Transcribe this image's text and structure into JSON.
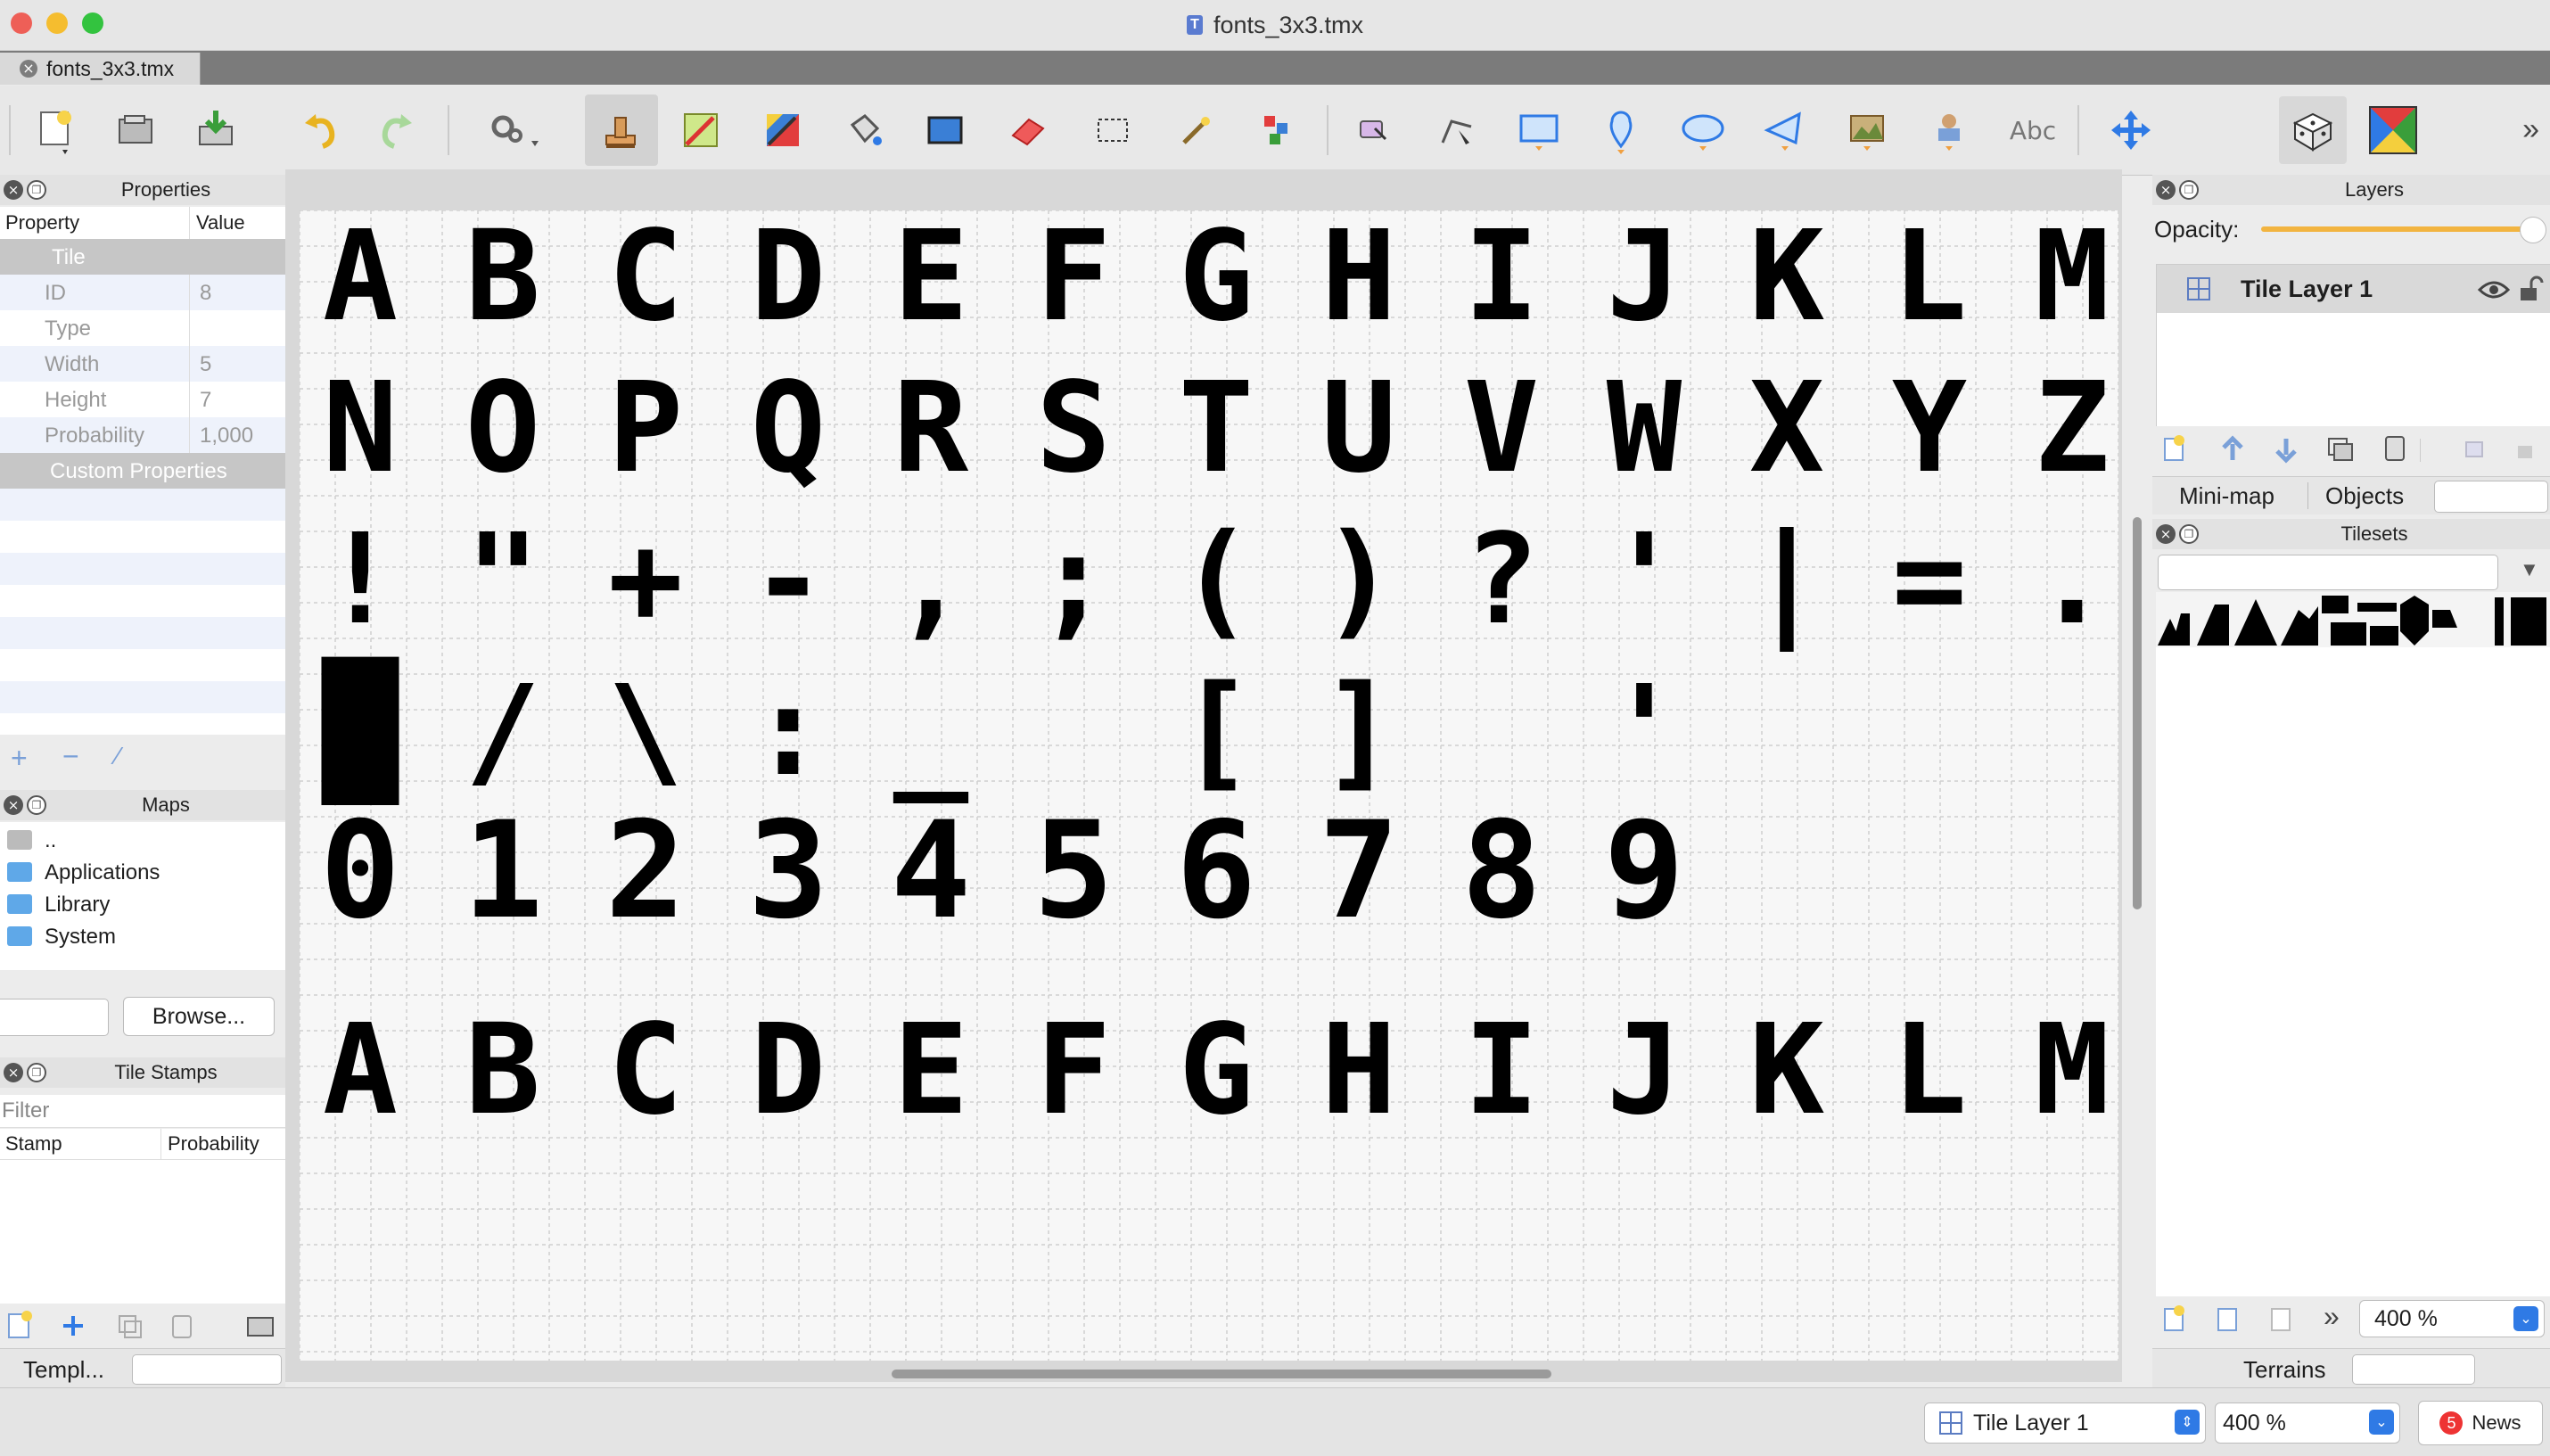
{
  "window": {
    "title": "fonts_3x3.tmx"
  },
  "tabs": [
    {
      "label": "fonts_3x3.tmx"
    }
  ],
  "toolbar": {
    "items": [
      {
        "icon": "new-map-icon"
      },
      {
        "icon": "open-file-icon"
      },
      {
        "icon": "save-icon"
      },
      {
        "icon": "undo-icon"
      },
      {
        "icon": "redo-icon"
      },
      {
        "icon": "commands-icon"
      },
      {
        "icon": "stamp-brush-icon",
        "selected": true
      },
      {
        "icon": "terrain-brush-icon"
      },
      {
        "icon": "wang-brush-icon"
      },
      {
        "icon": "bucket-fill-icon"
      },
      {
        "icon": "shape-fill-icon"
      },
      {
        "icon": "eraser-icon"
      },
      {
        "icon": "rect-select-icon"
      },
      {
        "icon": "magic-wand-icon"
      },
      {
        "icon": "select-same-tile-icon"
      },
      {
        "icon": "select-objects-icon"
      },
      {
        "icon": "edit-polygons-icon"
      },
      {
        "icon": "insert-rectangle-icon"
      },
      {
        "icon": "insert-point-icon"
      },
      {
        "icon": "insert-ellipse-icon"
      },
      {
        "icon": "insert-polygon-icon"
      },
      {
        "icon": "insert-tile-icon"
      },
      {
        "icon": "insert-template-icon"
      },
      {
        "icon": "insert-text-icon"
      },
      {
        "icon": "move-icon"
      },
      {
        "icon": "random-mode-icon"
      },
      {
        "icon": "wang-fill-icon"
      }
    ],
    "text_icon_label": "Abc",
    "more": "»"
  },
  "properties": {
    "title": "Properties",
    "col_property": "Property",
    "col_value": "Value",
    "section_tile": "Tile",
    "rows": [
      {
        "name": "ID",
        "value": "8"
      },
      {
        "name": "Type",
        "value": ""
      },
      {
        "name": "Width",
        "value": "5"
      },
      {
        "name": "Height",
        "value": "7"
      },
      {
        "name": "Probability",
        "value": "1,000"
      }
    ],
    "section_custom": "Custom Properties"
  },
  "maps": {
    "title": "Maps",
    "items": [
      "..",
      "Applications",
      "Library",
      "System"
    ],
    "browse_label": "Browse..."
  },
  "tile_stamps": {
    "title": "Tile Stamps",
    "filter_placeholder": "Filter",
    "col_stamp": "Stamp",
    "col_probability": "Probability",
    "templates_tab": "Templ..."
  },
  "layers": {
    "title": "Layers",
    "opacity_label": "Opacity:",
    "opacity": 1.0,
    "items": [
      {
        "name": "Tile Layer 1",
        "visible": true,
        "locked": false
      }
    ]
  },
  "side_tabs": [
    "Mini-map",
    "Objects"
  ],
  "tilesets": {
    "title": "Tilesets",
    "zoom": "400 %",
    "terrains_tab": "Terrains"
  },
  "glyph_rows": [
    "ABCDEFGHIJKLM",
    "NOPQRSTUVWXYZ",
    "!\"+-,;()?'|=.",
    "█/\\:_ [] ' ",
    "0123456789",
    "ABCDEFGHIJKLM"
  ],
  "status": {
    "layer": "Tile Layer 1",
    "zoom": "400 %",
    "news_count": "5",
    "news_label": "News"
  }
}
